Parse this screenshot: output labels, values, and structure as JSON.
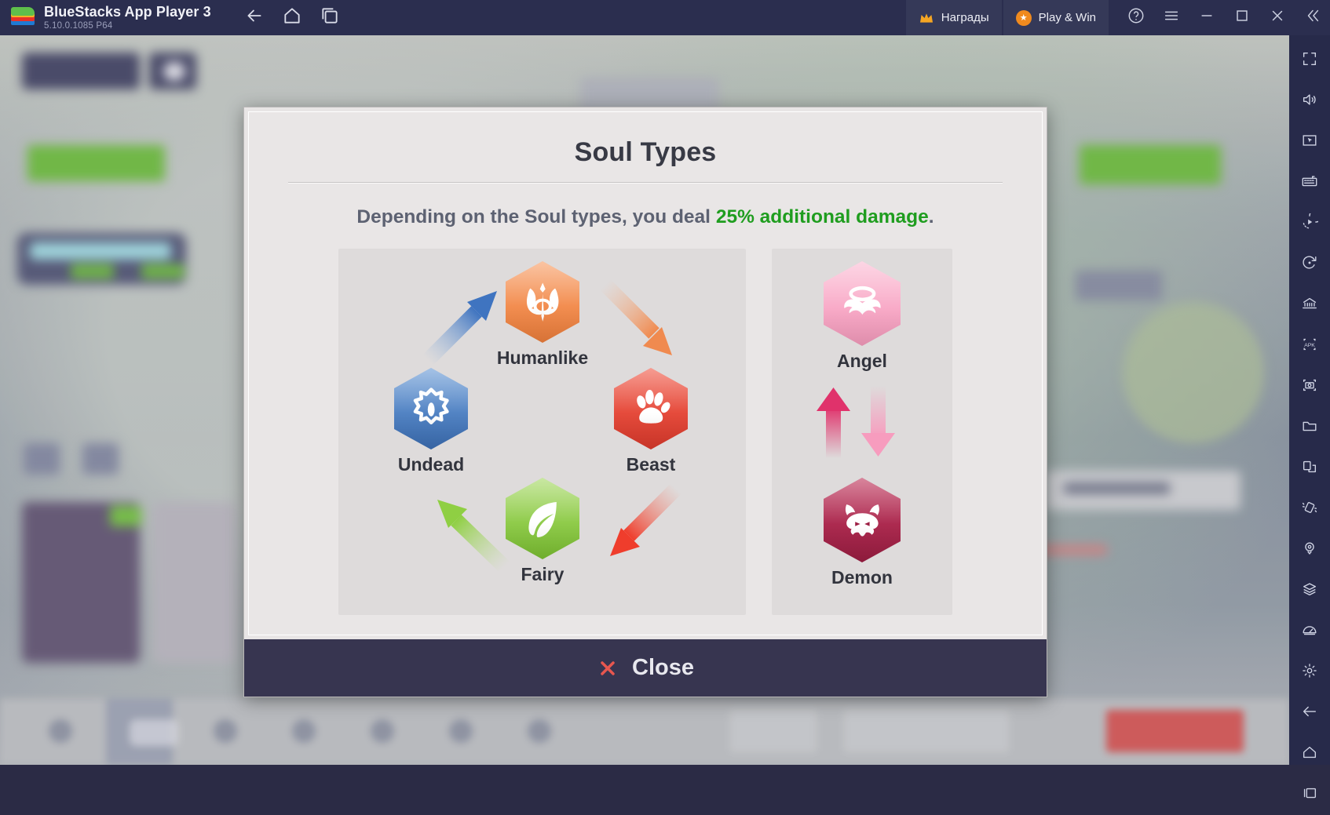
{
  "titlebar": {
    "app_name": "BlueStacks App Player 3",
    "version": "5.10.0.1085  P64",
    "nav": [
      {
        "name": "back-button",
        "icon": "arrow-left-icon"
      },
      {
        "name": "home-button",
        "icon": "home-icon"
      },
      {
        "name": "recents-button",
        "icon": "multi-window-icon"
      }
    ],
    "rewards_label": "Награды",
    "play_win_label": "Play & Win",
    "help_icon": "question-circle-icon",
    "menu_icon": "hamburger-menu-icon",
    "minimize_icon": "minimize-icon",
    "maximize_icon": "maximize-icon",
    "close_icon": "close-icon",
    "collapse_icon": "chevron-double-left-icon"
  },
  "sidebar": {
    "items": [
      {
        "name": "fullscreen-button",
        "icon": "fullscreen-icon"
      },
      {
        "name": "volume-button",
        "icon": "speaker-icon"
      },
      {
        "name": "game-controls-button",
        "icon": "cursor-box-icon"
      },
      {
        "name": "keyboard-controls-button",
        "icon": "keyboard-icon"
      },
      {
        "name": "macro-recorder-button",
        "icon": "play-circle-icon"
      },
      {
        "name": "rotate-button",
        "icon": "rotate-circle-icon"
      },
      {
        "name": "multi-instance-button",
        "icon": "instance-manager-icon"
      },
      {
        "name": "install-apk-button",
        "icon": "apk-icon"
      },
      {
        "name": "screenshot-button",
        "icon": "camera-icon"
      },
      {
        "name": "media-manager-button",
        "icon": "folder-icon"
      },
      {
        "name": "copy-to-pc-button",
        "icon": "copy-screen-icon"
      },
      {
        "name": "shake-button",
        "icon": "shake-icon"
      },
      {
        "name": "location-button",
        "icon": "location-pin-icon"
      },
      {
        "name": "layers-button",
        "icon": "layers-icon"
      },
      {
        "name": "performance-button",
        "icon": "speedometer-icon"
      },
      {
        "name": "settings-button",
        "icon": "gear-icon"
      },
      {
        "name": "android-back-button",
        "icon": "arrow-left-icon"
      },
      {
        "name": "android-home-button",
        "icon": "home-icon"
      },
      {
        "name": "android-recents-button",
        "icon": "recents-icon"
      }
    ]
  },
  "modal": {
    "title": "Soul Types",
    "subtitle_before": "Depending on the Soul types, you deal ",
    "subtitle_highlight": "25% additional damage",
    "subtitle_after": ".",
    "highlight_color": "#1f9d1f",
    "close_label": "Close",
    "close_icon": "x-icon",
    "cycle": {
      "nodes": [
        {
          "name": "soul-type-humanlike",
          "label": "Humanlike",
          "color": "#ef7f3c",
          "icon": "helm-sword-icon"
        },
        {
          "name": "soul-type-beast",
          "label": "Beast",
          "color": "#dd3a2c",
          "icon": "paw-icon"
        },
        {
          "name": "soul-type-fairy",
          "label": "Fairy",
          "color": "#7cc132",
          "icon": "leaf-icon"
        },
        {
          "name": "soul-type-undead",
          "label": "Undead",
          "color": "#3c6fb5",
          "icon": "skull-eye-icon"
        }
      ],
      "arrows": [
        {
          "name": "arrow-humanlike-to-beast",
          "from": "Humanlike",
          "to": "Beast",
          "color": "#f08a4f"
        },
        {
          "name": "arrow-beast-to-fairy",
          "from": "Beast",
          "to": "Fairy",
          "color": "#ef3d2c"
        },
        {
          "name": "arrow-fairy-to-undead",
          "from": "Fairy",
          "to": "Undead",
          "color": "#8fcf43"
        },
        {
          "name": "arrow-undead-to-humanlike",
          "from": "Undead",
          "to": "Humanlike",
          "color": "#3f74c0"
        }
      ]
    },
    "duo": {
      "nodes": [
        {
          "name": "soul-type-angel",
          "label": "Angel",
          "color": "#f79cbe",
          "icon": "halo-wings-icon"
        },
        {
          "name": "soul-type-demon",
          "label": "Demon",
          "color": "#9c1d42",
          "icon": "demon-face-icon"
        }
      ],
      "arrows": [
        {
          "name": "arrow-demon-to-angel",
          "direction": "up",
          "color": "#e0326b"
        },
        {
          "name": "arrow-angel-to-demon",
          "direction": "down",
          "color": "#f79cbe"
        }
      ]
    }
  }
}
